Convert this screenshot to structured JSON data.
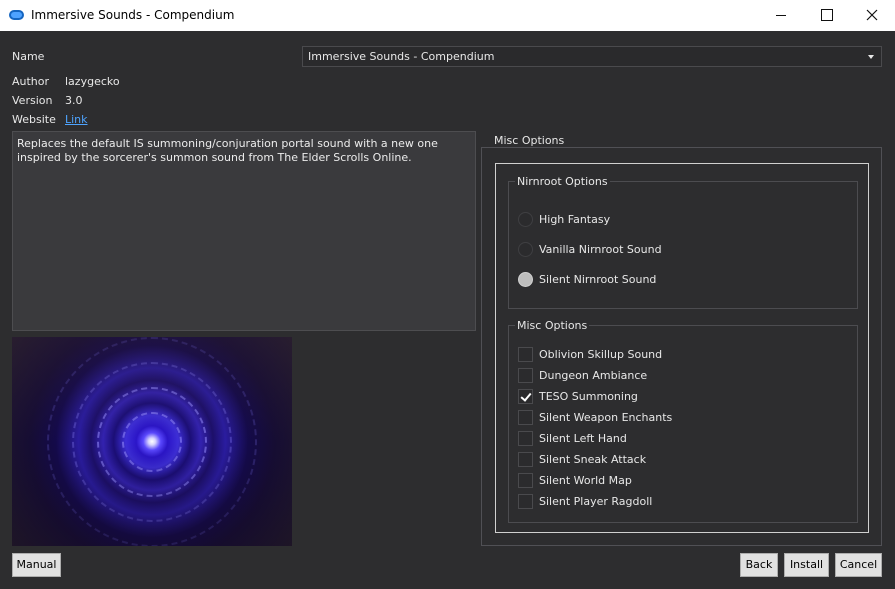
{
  "window": {
    "title": "Immersive Sounds - Compendium"
  },
  "info": {
    "name_label": "Name",
    "name_value": "Immersive Sounds - Compendium",
    "author_label": "Author",
    "author_value": "lazygecko",
    "version_label": "Version",
    "version_value": "3.0",
    "website_label": "Website",
    "website_link": "Link"
  },
  "description": "Replaces the default IS summoning/conjuration portal sound with a new one inspired by the sorcerer's summon sound from The Elder Scrolls Online.",
  "options": {
    "group_title": "Misc Options",
    "nirnroot": {
      "title": "Nirnroot Options",
      "items": [
        {
          "label": "High Fantasy",
          "selected": false
        },
        {
          "label": "Vanilla Nirnroot Sound",
          "selected": false
        },
        {
          "label": "Silent Nirnroot Sound",
          "selected": true
        }
      ]
    },
    "misc": {
      "title": "Misc Options",
      "items": [
        {
          "label": "Oblivion Skillup Sound",
          "checked": false
        },
        {
          "label": "Dungeon Ambiance",
          "checked": false
        },
        {
          "label": "TESO Summoning",
          "checked": true
        },
        {
          "label": "Silent Weapon Enchants",
          "checked": false
        },
        {
          "label": "Silent Left Hand",
          "checked": false
        },
        {
          "label": "Silent Sneak Attack",
          "checked": false
        },
        {
          "label": "Silent World Map",
          "checked": false
        },
        {
          "label": "Silent Player Ragdoll",
          "checked": false
        }
      ]
    }
  },
  "buttons": {
    "manual": "Manual",
    "back": "Back",
    "install": "Install",
    "cancel": "Cancel"
  },
  "icons": {
    "app": "app-icon",
    "minimize": "minimize-icon",
    "maximize": "maximize-icon",
    "close": "close-icon",
    "dropdown": "chevron-down-icon"
  }
}
